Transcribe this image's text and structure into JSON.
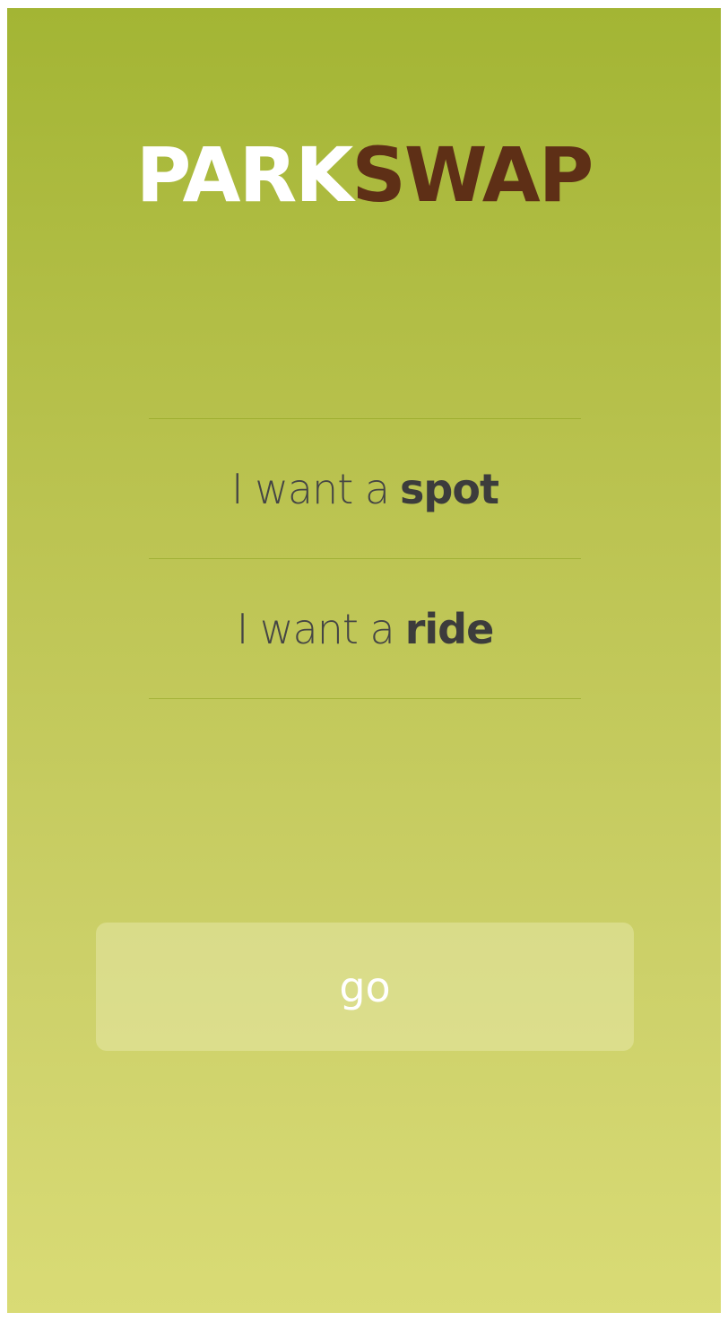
{
  "app": {
    "logo_part1": "PARK",
    "logo_part2": "SWAP"
  },
  "choices": [
    {
      "prefix": "I want a",
      "emphasis": "spot"
    },
    {
      "prefix": "I want a",
      "emphasis": "ride"
    }
  ],
  "actions": {
    "go_label": "go"
  },
  "colors": {
    "gradient_top": "#a3b534",
    "gradient_bottom": "#d9db75",
    "logo_accent": "#5e2f16",
    "text": "#3f3f3f"
  }
}
